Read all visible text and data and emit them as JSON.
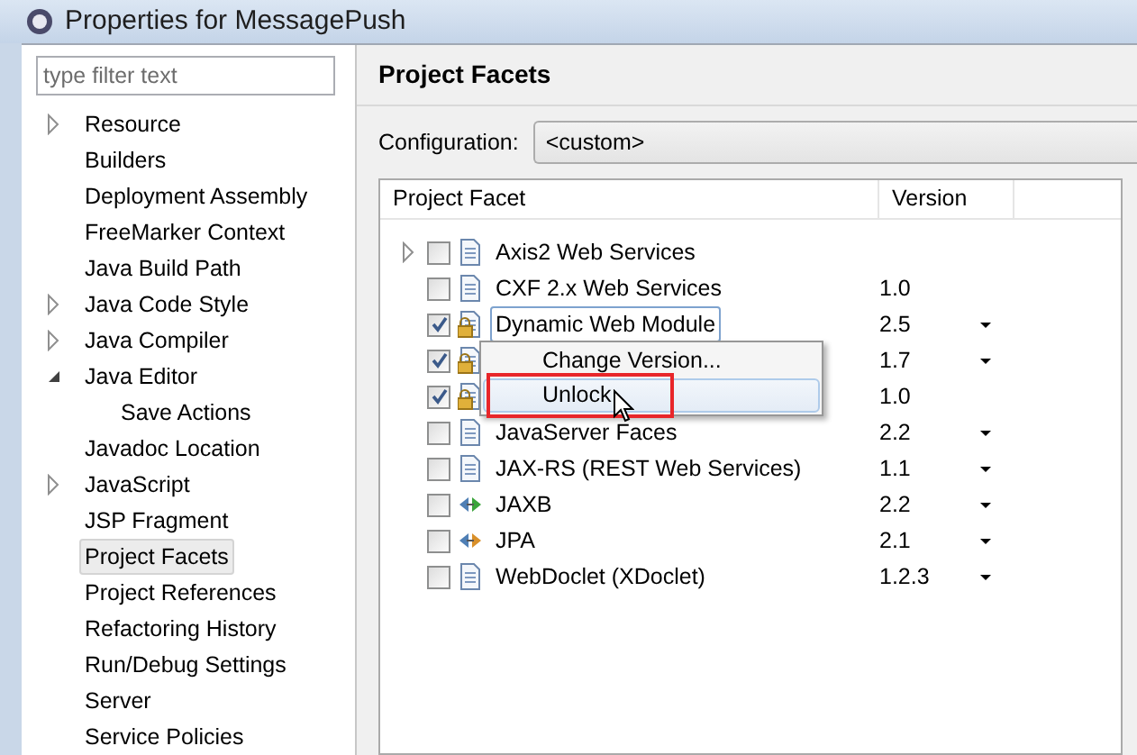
{
  "window": {
    "title": "Properties for MessagePush"
  },
  "filter": {
    "placeholder": "type filter text"
  },
  "sidebar": {
    "items": [
      {
        "label": "Resource",
        "expandable": true,
        "expanded": false,
        "selected": false
      },
      {
        "label": "Builders",
        "expandable": false,
        "expanded": false,
        "selected": false
      },
      {
        "label": "Deployment Assembly",
        "expandable": false,
        "expanded": false,
        "selected": false
      },
      {
        "label": "FreeMarker Context",
        "expandable": false,
        "expanded": false,
        "selected": false
      },
      {
        "label": "Java Build Path",
        "expandable": false,
        "expanded": false,
        "selected": false
      },
      {
        "label": "Java Code Style",
        "expandable": true,
        "expanded": false,
        "selected": false
      },
      {
        "label": "Java Compiler",
        "expandable": true,
        "expanded": false,
        "selected": false
      },
      {
        "label": "Java Editor",
        "expandable": true,
        "expanded": true,
        "selected": false,
        "children": [
          {
            "label": "Save Actions",
            "expandable": false,
            "expanded": false,
            "selected": false
          }
        ]
      },
      {
        "label": "Javadoc Location",
        "expandable": false,
        "expanded": false,
        "selected": false
      },
      {
        "label": "JavaScript",
        "expandable": true,
        "expanded": false,
        "selected": false
      },
      {
        "label": "JSP Fragment",
        "expandable": false,
        "expanded": false,
        "selected": false
      },
      {
        "label": "Project Facets",
        "expandable": false,
        "expanded": false,
        "selected": true
      },
      {
        "label": "Project References",
        "expandable": false,
        "expanded": false,
        "selected": false
      },
      {
        "label": "Refactoring History",
        "expandable": false,
        "expanded": false,
        "selected": false
      },
      {
        "label": "Run/Debug Settings",
        "expandable": false,
        "expanded": false,
        "selected": false
      },
      {
        "label": "Server",
        "expandable": false,
        "expanded": false,
        "selected": false
      },
      {
        "label": "Service Policies",
        "expandable": false,
        "expanded": false,
        "selected": false
      }
    ]
  },
  "page": {
    "title": "Project Facets",
    "configuration_label": "Configuration:",
    "configuration_value": "<custom>"
  },
  "table": {
    "columns": [
      "Project Facet",
      "Version"
    ],
    "rows": [
      {
        "kind": "facet",
        "name": "Axis2 Web Services",
        "checked": false,
        "locked": false,
        "expandable": true,
        "dropdown": false
      },
      {
        "kind": "facet",
        "name": "CXF 2.x Web Services",
        "version": "1.0",
        "checked": false,
        "locked": false,
        "expandable": false,
        "dropdown": false
      },
      {
        "kind": "facet",
        "name": "Dynamic Web Module",
        "version": "2.5",
        "checked": true,
        "locked": true,
        "expandable": false,
        "dropdown": true,
        "focused": true
      },
      {
        "kind": "facet",
        "version": "1.7",
        "checked": true,
        "locked": true,
        "expandable": false,
        "dropdown": true
      },
      {
        "kind": "facet",
        "version": "1.0",
        "checked": true,
        "locked": true,
        "expandable": false,
        "dropdown": false
      },
      {
        "kind": "facet",
        "name": "JavaServer Faces",
        "version": "2.2",
        "checked": false,
        "locked": false,
        "expandable": false,
        "dropdown": true
      },
      {
        "kind": "facet",
        "name": "JAX-RS (REST Web Services)",
        "version": "1.1",
        "checked": false,
        "locked": false,
        "expandable": false,
        "dropdown": true
      },
      {
        "kind": "binding",
        "color": "#3aa43a",
        "name": "JAXB",
        "version": "2.2",
        "checked": false,
        "locked": false,
        "expandable": false,
        "dropdown": true
      },
      {
        "kind": "binding",
        "color": "#d9902a",
        "name": "JPA",
        "version": "2.1",
        "checked": false,
        "locked": false,
        "expandable": false,
        "dropdown": true
      },
      {
        "kind": "facet",
        "name": "WebDoclet (XDoclet)",
        "version": "1.2.3",
        "checked": false,
        "locked": false,
        "expandable": false,
        "dropdown": true
      }
    ]
  },
  "context_menu": {
    "items": [
      {
        "label": "Change Version...",
        "selected": false
      },
      {
        "label": "Unlock",
        "selected": true,
        "annotated": true
      }
    ]
  }
}
